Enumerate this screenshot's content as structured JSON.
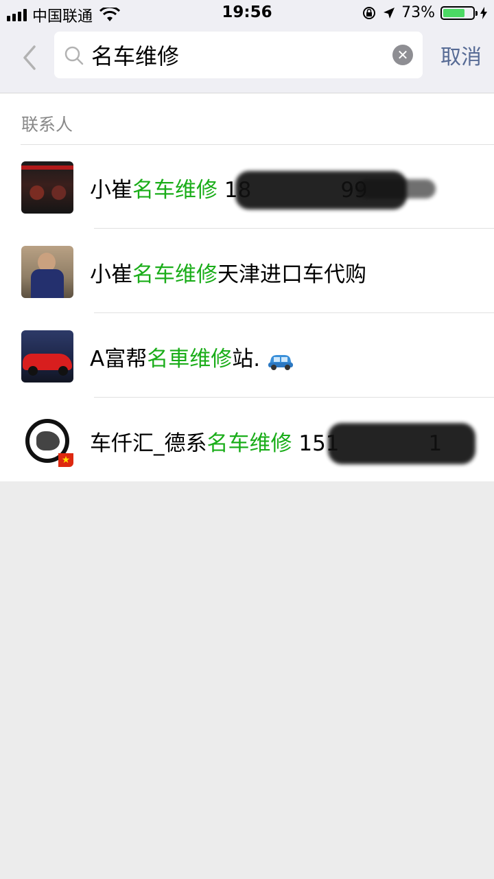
{
  "status_bar": {
    "carrier": "中国联通",
    "time": "19:56",
    "battery_percent": "73%",
    "battery_level": 0.73,
    "icons": [
      "signal-icon",
      "wifi-icon",
      "rotation-lock-icon",
      "location-arrow-icon",
      "battery-icon",
      "charging-bolt-icon"
    ]
  },
  "search": {
    "query": "名车维修",
    "cancel_label": "取消"
  },
  "results": {
    "section_title": "联系人",
    "contacts": [
      {
        "prefix": "小崔",
        "highlight": "名车维修",
        "suffix": " 18",
        "tail": "99"
      },
      {
        "prefix": "小崔",
        "highlight": "名车维修",
        "suffix": "天津进口车代购"
      },
      {
        "prefix": "A富帮",
        "highlight": "名車维修",
        "suffix": "站."
      },
      {
        "prefix": "车仟汇_德系",
        "highlight": "名车维修",
        "suffix": " 151",
        "tail": "1"
      }
    ]
  },
  "colors": {
    "highlight": "#1aad19",
    "link": "#576b95",
    "battery": "#4cd964"
  }
}
